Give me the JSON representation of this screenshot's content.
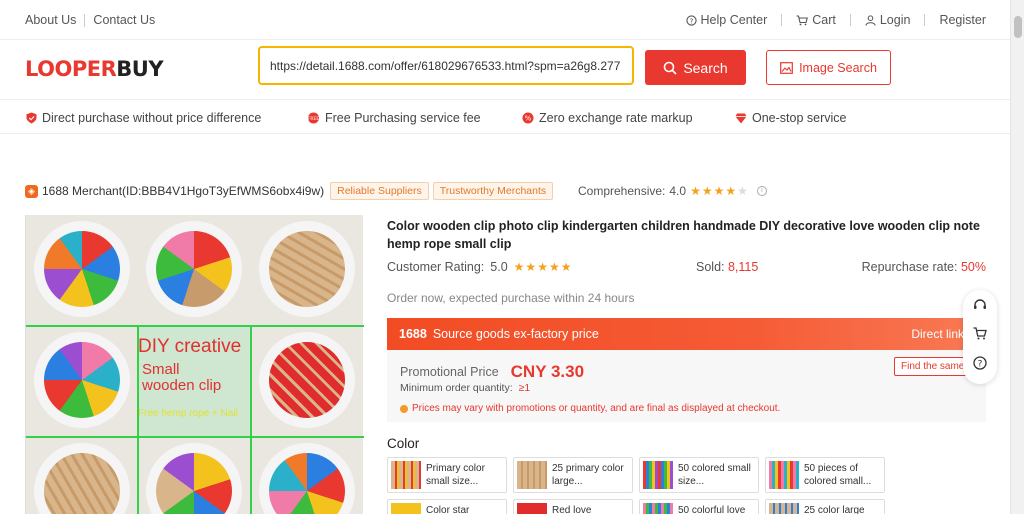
{
  "topbar": {
    "about": "About Us",
    "contact": "Contact Us",
    "help": "Help Center",
    "cart": "Cart",
    "login": "Login",
    "register": "Register"
  },
  "header": {
    "logo_red_a": "L",
    "logo_red_b": "O",
    "logo_red_c": "OPER",
    "logo_dark": "BUY",
    "search_value": "https://detail.1688.com/offer/618029676533.html?spm=a26g8.277",
    "search_label": "Search",
    "image_search_label": "Image Search"
  },
  "features": [
    "Direct purchase without price difference",
    "Free Purchasing service fee",
    "Zero exchange rate markup",
    "One-stop service"
  ],
  "merchant": {
    "name": "1688 Merchant(ID:BBB4V1HgoT3yEfWMS6obx4i9w)",
    "tag1": "Reliable Suppliers",
    "tag2": "Trustworthy Merchants",
    "comprehensive_label": "Comprehensive:",
    "comprehensive_value": "4.0",
    "comprehensive_stars": 4
  },
  "gallery": {
    "overlay_line1": "DIY creative",
    "overlay_line2": "Small",
    "overlay_line3": "wooden clip",
    "overlay_line4": "Free hemp rope + Nail"
  },
  "product": {
    "title": "Color wooden clip photo clip kindergarten children handmade DIY decorative love wooden clip note hemp rope small clip",
    "rating_label": "Customer Rating:",
    "rating_value": "5.0",
    "rating_stars": 5,
    "sold_label": "Sold:",
    "sold_value": "8,115",
    "repurchase_label": "Repurchase rate:",
    "repurchase_value": "50%",
    "order_note": "Order now, expected purchase within 24 hours"
  },
  "price": {
    "head_brand": "1688",
    "head_label": "Source goods ex-factory price",
    "direct_link": "Direct link",
    "promo_label": "Promotional Price",
    "promo_value": "CNY 3.30",
    "moq_label": "Minimum order quantity:",
    "moq_value": "≥1",
    "note": "Prices may vary with promotions or quantity, and are final as displayed at checkout.",
    "find_same": "Find the same"
  },
  "color_section": {
    "label": "Color",
    "options": [
      "Primary color small size...",
      "25 primary color large...",
      "50 colored small size...",
      "50 pieces of colored small...",
      "Color star",
      "Red love",
      "50 colorful love",
      "25 color large"
    ]
  },
  "colors": {
    "brand_red": "#e8382f",
    "highlight_yellow": "#f7b500",
    "star_orange": "#f4a11c"
  }
}
